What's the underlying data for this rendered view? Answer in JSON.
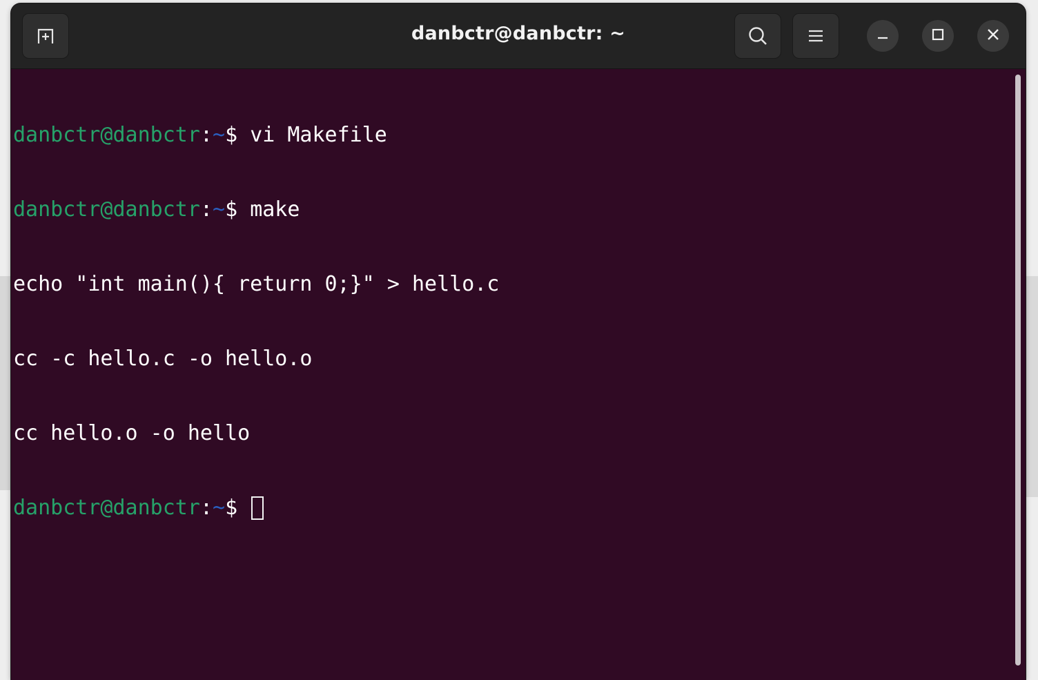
{
  "window": {
    "title": "danbctr@danbctr: ~"
  },
  "icons": {
    "new_tab": "new-tab-icon",
    "search": "search-icon",
    "menu": "hamburger-menu-icon",
    "minimize": "minimize-icon",
    "maximize": "maximize-icon",
    "close": "close-icon"
  },
  "colors": {
    "terminal_bg": "#300a24",
    "prompt_user": "#26a269",
    "prompt_path": "#2a5fbf",
    "text": "#ffffff",
    "headerbar_bg": "#232323"
  },
  "terminal": {
    "lines": [
      {
        "user": "danbctr@danbctr",
        "sep": ":",
        "path": "~",
        "sym": "$ ",
        "cmd": "vi Makefile"
      },
      {
        "user": "danbctr@danbctr",
        "sep": ":",
        "path": "~",
        "sym": "$ ",
        "cmd": "make"
      },
      {
        "output": "echo \"int main(){ return 0;}\" > hello.c"
      },
      {
        "output": "cc -c hello.c -o hello.o"
      },
      {
        "output": "cc hello.o -o hello"
      },
      {
        "user": "danbctr@danbctr",
        "sep": ":",
        "path": "~",
        "sym": "$ ",
        "cmd": ""
      }
    ]
  }
}
